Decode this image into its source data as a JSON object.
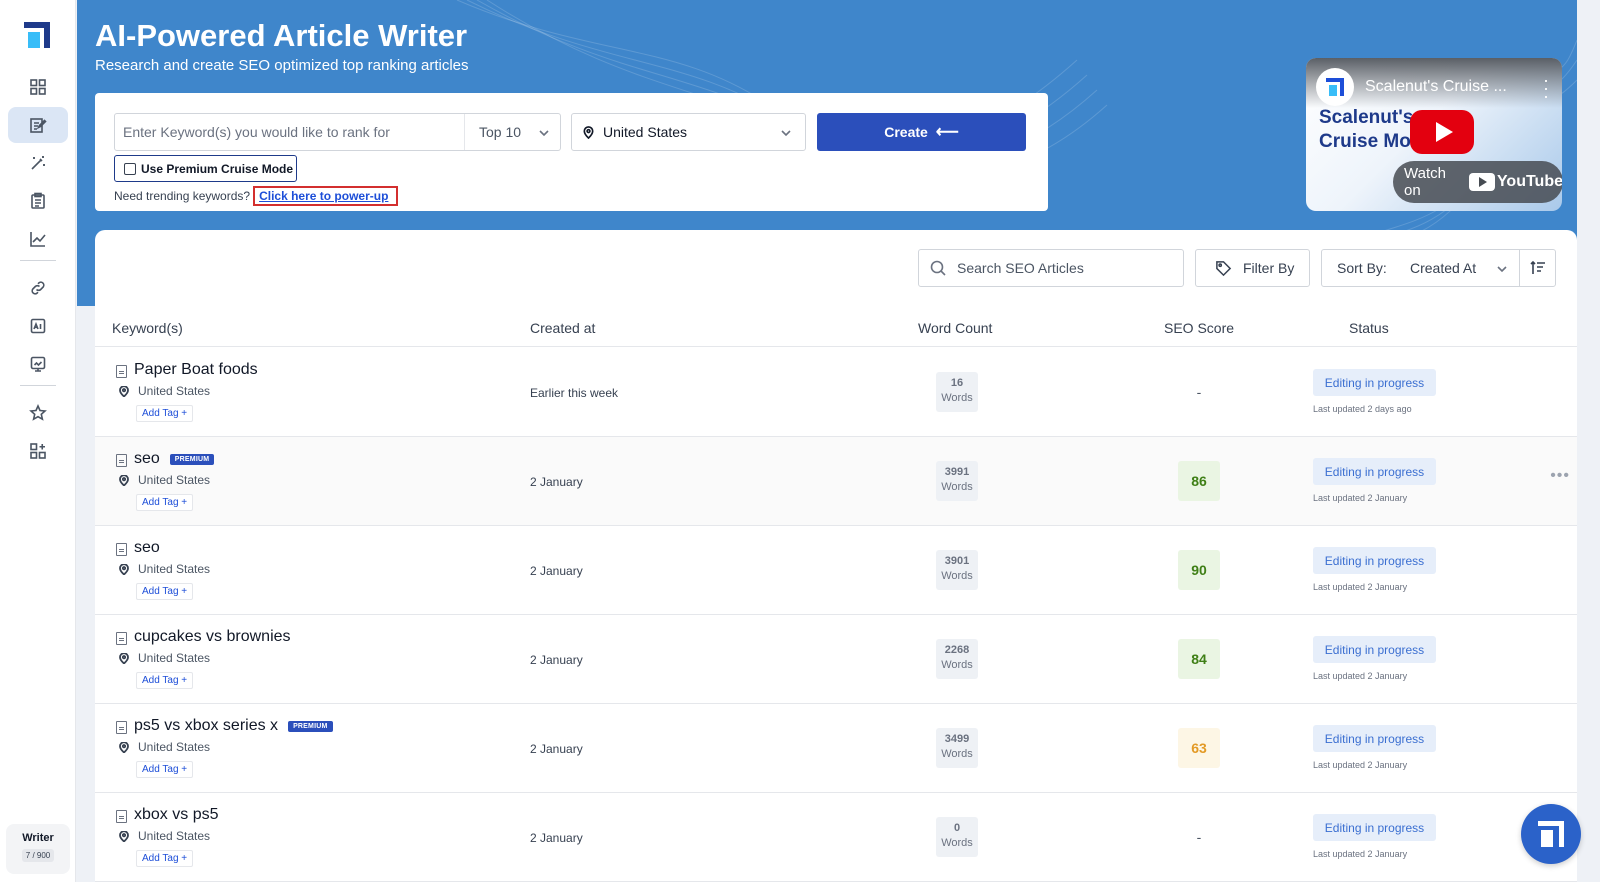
{
  "sidebar": {
    "plan_name": "Writer",
    "plan_count": "7 / 900",
    "icons": [
      "dashboard-icon",
      "article-writer-icon",
      "magic-wand-icon",
      "clipboard-icon",
      "analytics-icon",
      "link-icon",
      "ai-image-icon",
      "report-icon",
      "star-icon",
      "apps-icon"
    ]
  },
  "hero": {
    "title": "AI-Powered Article Writer",
    "subtitle": "Research and create SEO optimized top ranking articles"
  },
  "create_form": {
    "keyword_placeholder": "Enter Keyword(s) you would like to rank for",
    "keyword_value": "",
    "top_select": "Top 10",
    "country": "United States",
    "create_label": "Create",
    "create_arrow": "⟵",
    "premium_label": "Use Premium Cruise Mode",
    "premium_checked": false,
    "trend_text": "Need trending keywords?",
    "power_up_link": "Click here to power-up"
  },
  "video": {
    "title": "Scalenut's Cruise ...",
    "brand_line1": "Scalenut's",
    "brand_line2": "Cruise Mo",
    "watch_on": "Watch on",
    "youtube": "YouTube"
  },
  "toolbar": {
    "search_placeholder": "Search SEO Articles",
    "filter_label": "Filter By",
    "sort_label": "Sort By:",
    "sort_value": "Created At"
  },
  "table": {
    "headers": {
      "keyword": "Keyword(s)",
      "created": "Created at",
      "word_count": "Word Count",
      "seo_score": "SEO Score",
      "status": "Status"
    },
    "add_tag_label": "Add Tag +",
    "premium_badge": "PREMIUM",
    "words_label": "Words",
    "rows": [
      {
        "keyword": "Paper Boat foods",
        "premium": false,
        "location": "United States",
        "created": "Earlier this week",
        "word_count": "16",
        "seo_score": "-",
        "score_style": "none",
        "status": "Editing in progress",
        "updated": "Last updated 2 days ago"
      },
      {
        "keyword": "seo",
        "premium": true,
        "location": "United States",
        "created": "2 January",
        "word_count": "3991",
        "seo_score": "86",
        "score_style": "green",
        "status": "Editing in progress",
        "updated": "Last updated 2 January"
      },
      {
        "keyword": "seo",
        "premium": false,
        "location": "United States",
        "created": "2 January",
        "word_count": "3901",
        "seo_score": "90",
        "score_style": "green",
        "status": "Editing in progress",
        "updated": "Last updated 2 January"
      },
      {
        "keyword": "cupcakes vs brownies",
        "premium": false,
        "location": "United States",
        "created": "2 January",
        "word_count": "2268",
        "seo_score": "84",
        "score_style": "green",
        "status": "Editing in progress",
        "updated": "Last updated 2 January"
      },
      {
        "keyword": "ps5 vs xbox series x",
        "premium": true,
        "location": "United States",
        "created": "2 January",
        "word_count": "3499",
        "seo_score": "63",
        "score_style": "amber",
        "status": "Editing in progress",
        "updated": "Last updated 2 January"
      },
      {
        "keyword": "xbox vs ps5",
        "premium": false,
        "location": "United States",
        "created": "2 January",
        "word_count": "0",
        "seo_score": "-",
        "score_style": "none",
        "status": "Editing in progress",
        "updated": "Last updated 2 January"
      }
    ]
  },
  "colors": {
    "hero_bg": "#3f86cb",
    "primary": "#2b4fbb",
    "status_text": "#3b6fd1",
    "score_green": "#3f7f16",
    "score_amber": "#e39a25"
  }
}
